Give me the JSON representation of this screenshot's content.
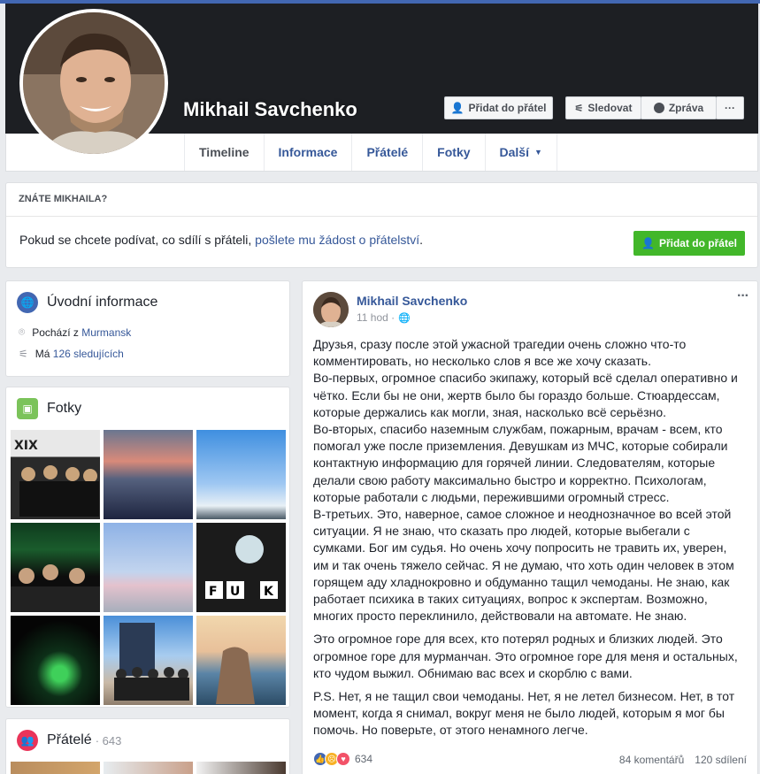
{
  "profile": {
    "name": "Mikhail Savchenko",
    "add_friend": "Přidat do přátel",
    "follow": "Sledovat",
    "message": "Zpráva",
    "more": "···"
  },
  "nav": {
    "tabs": [
      "Timeline",
      "Informace",
      "Přátelé",
      "Fotky",
      "Další"
    ]
  },
  "know": {
    "title": "ZNÁTE MIKHAILA?",
    "text": "Pokud se chcete podívat, co sdílí s přáteli, ",
    "link": "pošlete mu žádost o přátelství",
    "suffix": ".",
    "button": "Přidat do přátel"
  },
  "intro": {
    "title": "Úvodní informace",
    "from_prefix": "Pochází z ",
    "from_city": "Murmansk",
    "followers_prefix": "Má ",
    "followers_link": "126 sledujících"
  },
  "photos": {
    "title": "Fotky"
  },
  "friends": {
    "title": "Přátelé",
    "count": "· 643"
  },
  "post": {
    "author": "Mikhail Savchenko",
    "time": "11 hod ·",
    "menu": "···",
    "paragraphs": [
      "Друзья, сразу после этой ужасной трагедии очень сложно что-то комментировать, но несколько слов я все же хочу сказать.\nВо-первых, огромное спасибо экипажу, который всё сделал оперативно и чётко. Если бы не они, жертв было бы гораздо больше. Стюардессам, которые держались как могли, зная, насколько всё серьёзно.\nВо-вторых, спасибо наземным службам, пожарным, врачам - всем, кто помогал уже после приземления. Девушкам из МЧС, которые собирали контактную информацию для горячей линии. Следователям, которые делали свою работу максимально быстро и корректно. Психологам, которые работали с людьми, пережившими огромный стресс.\nВ-третьих. Это, наверное, самое сложное и неоднозначное во всей этой ситуации. Я не знаю, что сказать про людей, которые выбегали с сумками. Бог им судья. Но очень хочу попросить не травить их, уверен, им и так очень тяжело сейчас. Я не думаю, что хоть один человек в этом горящем аду хладнокровно и обдуманно тащил чемоданы. Не знаю, как работает психика в таких ситуациях, вопрос к экспертам. Возможно, многих просто переклинило, действовали на автомате. Не знаю.",
      "Это огромное горе для всех, кто потерял родных и близких людей. Это огромное горе для мурманчан. Это огромное горе для меня и остальных, кто чудом выжил. Обнимаю вас всех и скорблю с вами.",
      "P.S. Нет, я не тащил свои чемоданы. Нет, я не летел бизнесом. Нет, в тот момент, когда я снимал, вокруг меня не было людей, которым я мог бы помочь. Но поверьте, от этого ненамного легче."
    ],
    "reaction_count": "634",
    "comments": "84 komentářů",
    "shares": "120 sdílení"
  }
}
